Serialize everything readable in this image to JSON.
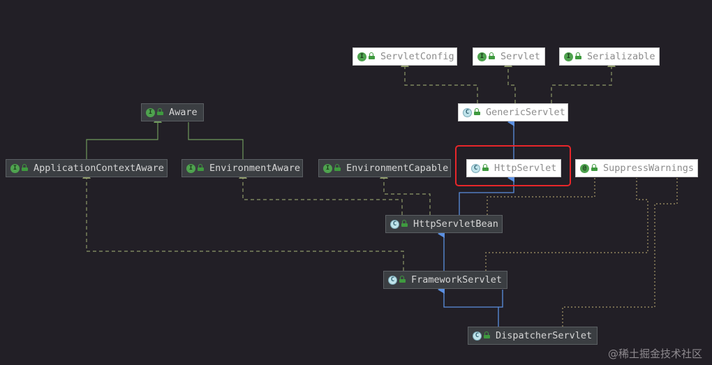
{
  "nodes": {
    "servlet_config": {
      "label": "ServletConfig",
      "kind": "I"
    },
    "servlet": {
      "label": "Servlet",
      "kind": "I"
    },
    "serializable": {
      "label": "Serializable",
      "kind": "I"
    },
    "generic_servlet": {
      "label": "GenericServlet",
      "kind": "C"
    },
    "aware": {
      "label": "Aware",
      "kind": "I"
    },
    "application_context_aware": {
      "label": "ApplicationContextAware",
      "kind": "I"
    },
    "environment_aware": {
      "label": "EnvironmentAware",
      "kind": "I"
    },
    "environment_capable": {
      "label": "EnvironmentCapable",
      "kind": "I"
    },
    "http_servlet": {
      "label": "HttpServlet",
      "kind": "C"
    },
    "suppress_warnings": {
      "label": "SuppressWarnings",
      "kind": "@"
    },
    "http_servlet_bean": {
      "label": "HttpServletBean",
      "kind": "C"
    },
    "framework_servlet": {
      "label": "FrameworkServlet",
      "kind": "C"
    },
    "dispatcher_servlet": {
      "label": "DispatcherServlet",
      "kind": "C"
    }
  },
  "edges": [
    {
      "from": "generic_servlet",
      "to": "servlet_config",
      "relation": "implements"
    },
    {
      "from": "generic_servlet",
      "to": "servlet",
      "relation": "implements"
    },
    {
      "from": "generic_servlet",
      "to": "serializable",
      "relation": "implements"
    },
    {
      "from": "http_servlet",
      "to": "generic_servlet",
      "relation": "extends"
    },
    {
      "from": "application_context_aware",
      "to": "aware",
      "relation": "extends-interface"
    },
    {
      "from": "environment_aware",
      "to": "aware",
      "relation": "extends-interface"
    },
    {
      "from": "http_servlet_bean",
      "to": "http_servlet",
      "relation": "extends"
    },
    {
      "from": "http_servlet_bean",
      "to": "environment_aware",
      "relation": "implements"
    },
    {
      "from": "http_servlet_bean",
      "to": "environment_capable",
      "relation": "implements"
    },
    {
      "from": "framework_servlet",
      "to": "http_servlet_bean",
      "relation": "extends"
    },
    {
      "from": "framework_servlet",
      "to": "application_context_aware",
      "relation": "implements"
    },
    {
      "from": "dispatcher_servlet",
      "to": "framework_servlet",
      "relation": "extends"
    },
    {
      "from": "framework_servlet",
      "to": "suppress_warnings",
      "relation": "annotated"
    },
    {
      "from": "dispatcher_servlet",
      "to": "suppress_warnings",
      "relation": "annotated"
    },
    {
      "from": "http_servlet_bean",
      "to": "suppress_warnings",
      "relation": "annotated"
    }
  ],
  "highlighted_node": "http_servlet",
  "colors": {
    "background": "#221f26",
    "extends": "#5b8fe0",
    "implements": "#8e9a6a",
    "extends_interface": "#6f9a5c",
    "annotated": "#a89a6a",
    "highlight": "#e8262a"
  },
  "watermark": "@稀土掘金技术社区"
}
